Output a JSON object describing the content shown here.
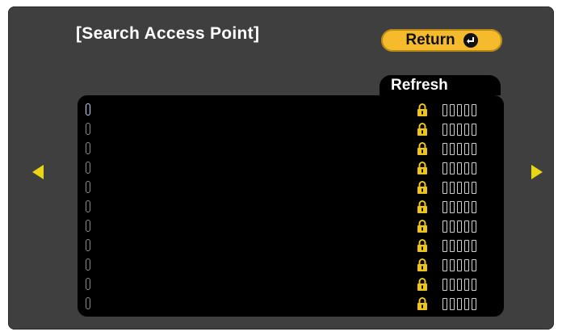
{
  "window": {
    "title": "[Search Access Point]"
  },
  "buttons": {
    "return_label": "Return",
    "refresh_label": "Refresh"
  },
  "access_points": [
    {
      "ssid": "",
      "selected": true,
      "secured": true,
      "signal_bars": 5,
      "signal_level": 0
    },
    {
      "ssid": "",
      "selected": false,
      "secured": true,
      "signal_bars": 5,
      "signal_level": 0
    },
    {
      "ssid": "",
      "selected": false,
      "secured": true,
      "signal_bars": 5,
      "signal_level": 0
    },
    {
      "ssid": "",
      "selected": false,
      "secured": true,
      "signal_bars": 5,
      "signal_level": 0
    },
    {
      "ssid": "",
      "selected": false,
      "secured": true,
      "signal_bars": 5,
      "signal_level": 0
    },
    {
      "ssid": "",
      "selected": false,
      "secured": true,
      "signal_bars": 5,
      "signal_level": 0
    },
    {
      "ssid": "",
      "selected": false,
      "secured": true,
      "signal_bars": 5,
      "signal_level": 0
    },
    {
      "ssid": "",
      "selected": false,
      "secured": true,
      "signal_bars": 5,
      "signal_level": 0
    },
    {
      "ssid": "",
      "selected": false,
      "secured": true,
      "signal_bars": 5,
      "signal_level": 0
    },
    {
      "ssid": "",
      "selected": false,
      "secured": true,
      "signal_bars": 5,
      "signal_level": 0
    },
    {
      "ssid": "",
      "selected": false,
      "secured": true,
      "signal_bars": 5,
      "signal_level": 0
    }
  ],
  "icons": {
    "return": "enter-icon",
    "lock": "lock-icon",
    "signal": "signal-strength-icon",
    "prev_page": "arrow-left-icon",
    "next_page": "arrow-right-icon"
  },
  "colors": {
    "background": "#3f3f3f",
    "accent": "#f5bb2c",
    "lock": "#f0c419",
    "arrow": "#e8d514",
    "list_bg": "#000000"
  }
}
